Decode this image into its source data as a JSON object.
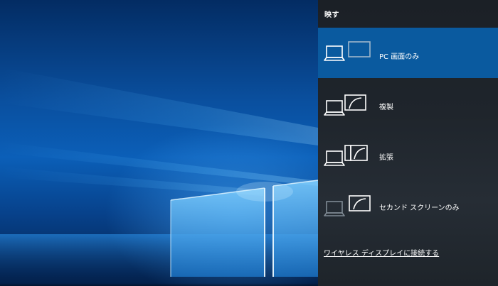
{
  "panel": {
    "title": "映す",
    "options": [
      {
        "label": "PC 画面のみ",
        "icon": "pc-screen-only-icon",
        "selected": true
      },
      {
        "label": "複製",
        "icon": "duplicate-icon",
        "selected": false
      },
      {
        "label": "拡張",
        "icon": "extend-icon",
        "selected": false
      },
      {
        "label": "セカンド スクリーンのみ",
        "icon": "second-screen-only-icon",
        "selected": false
      }
    ],
    "wireless_link": "ワイヤレス ディスプレイに接続する"
  },
  "colors": {
    "selected_background": "#0a5a9f",
    "panel_background": "#1f252c",
    "wallpaper_blue": "#0b5fb8"
  }
}
